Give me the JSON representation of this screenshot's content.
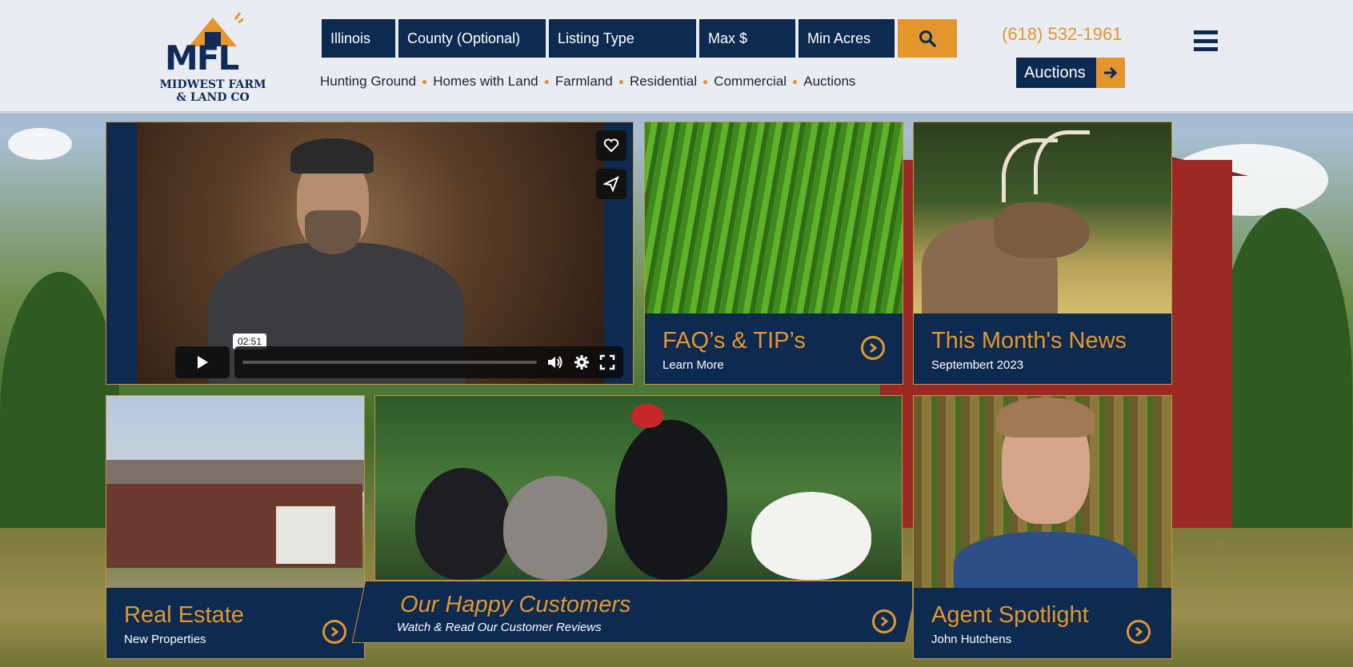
{
  "colors": {
    "navy": "#0d2a50",
    "orange": "#e4962c",
    "header_bg": "#e9edf3"
  },
  "logo": {
    "mark": "MFL",
    "line1": "MIDWEST FARM",
    "line2": "& LAND CO"
  },
  "search": {
    "state": "Illinois",
    "county": "County (Optional)",
    "listing_type": "Listing Type",
    "max_price": "Max $",
    "min_acres": "Min Acres",
    "button_icon": "search-icon"
  },
  "categories": [
    "Hunting Ground",
    "Homes with Land",
    "Farmland",
    "Residential",
    "Commercial",
    "Auctions"
  ],
  "phone": "(618) 532-1961",
  "auctions_button": "Auctions",
  "video": {
    "time": "02:51"
  },
  "tiles": {
    "faq": {
      "title": "FAQ’s & TIP’s",
      "subtitle": "Learn More"
    },
    "news": {
      "title": "This Month's News",
      "subtitle": "Septembert 2023"
    },
    "realestate": {
      "title": "Real Estate",
      "subtitle": "New Properties"
    },
    "customers": {
      "title": "Our Happy Customers",
      "subtitle": "Watch & Read Our Customer Reviews"
    },
    "agent": {
      "title": "Agent Spotlight",
      "subtitle": "John Hutchens"
    }
  }
}
